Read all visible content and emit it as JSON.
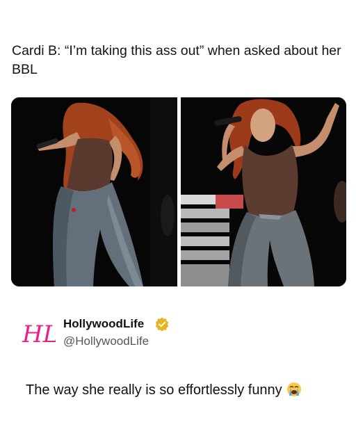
{
  "post": {
    "caption": "Cardi B: “I’m taking this ass out” when asked about her BBL"
  },
  "media": {
    "images": [
      {
        "name": "photo-performer-back-view"
      },
      {
        "name": "photo-performer-front-view"
      }
    ]
  },
  "reply": {
    "author_name": "HollywoodLife",
    "author_handle": "@HollywoodLife",
    "avatar_label": "HL",
    "verified_icon": "verified-badge-icon",
    "text": "The way she really is so effortlessly funny",
    "emoji": "loudly-crying-face-icon"
  },
  "colors": {
    "brand_pink": "#e8208a",
    "verified_gold": "#e6b422"
  }
}
